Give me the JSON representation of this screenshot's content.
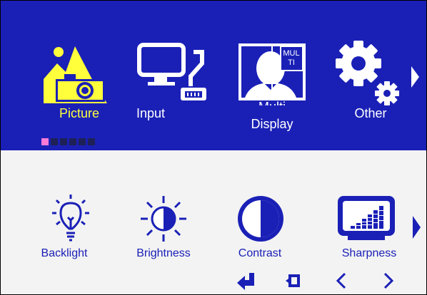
{
  "top_menu": {
    "items": [
      {
        "label": "Picture",
        "icon": "picture-icon",
        "selected": true
      },
      {
        "label": "Input",
        "icon": "input-icon",
        "selected": false
      },
      {
        "label": "Multi",
        "label2": "Display",
        "icon": "multi-display-icon",
        "overlay_text": "MUL",
        "overlay_text2": "TI",
        "selected": false
      },
      {
        "label": "Other",
        "icon": "gear-icon",
        "selected": false
      }
    ],
    "page_indicator": {
      "count": 6,
      "active": 1
    },
    "next_arrow": "chevron-right-icon"
  },
  "sub_menu": {
    "items": [
      {
        "label": "Backlight",
        "icon": "backlight-icon"
      },
      {
        "label": "Brightness",
        "icon": "brightness-icon"
      },
      {
        "label": "Contrast",
        "icon": "contrast-icon"
      },
      {
        "label": "Sharpness",
        "icon": "sharpness-icon"
      }
    ],
    "next_arrow": "chevron-right-icon"
  },
  "nav_keys": [
    "enter-icon",
    "exit-icon",
    "chevron-left-icon",
    "chevron-right-icon"
  ],
  "colors": {
    "header_bg": "#1a20b6",
    "body_bg": "#f3f3f3",
    "selected_text": "#ffff3c",
    "accent": "#1a20b6",
    "indicator_active": "#ff7bd8",
    "indicator_inactive": "#1e2157"
  }
}
